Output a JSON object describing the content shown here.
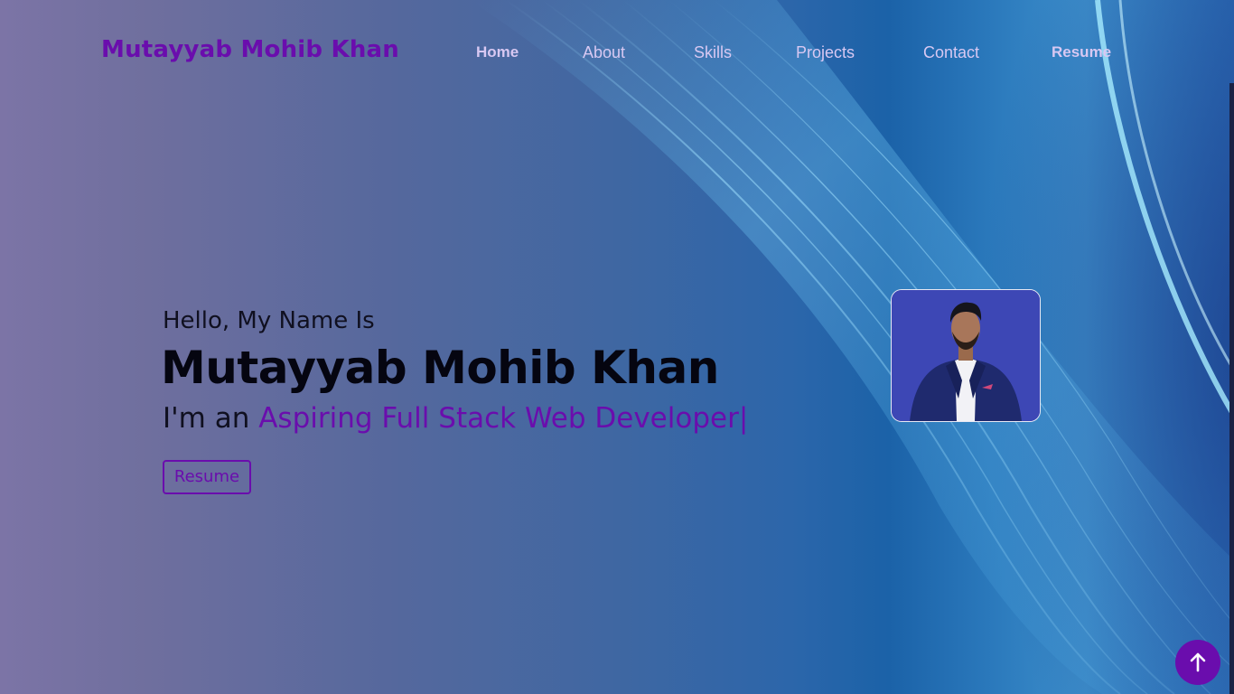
{
  "header": {
    "brand": "Mutayyab Mohib Khan"
  },
  "nav": {
    "items": [
      {
        "label": "Home"
      },
      {
        "label": "About"
      },
      {
        "label": "Skills"
      },
      {
        "label": "Projects"
      },
      {
        "label": "Contact"
      },
      {
        "label": "Resume"
      }
    ]
  },
  "hero": {
    "greeting": "Hello, My Name Is",
    "name": "Mutayyab Mohib Khan",
    "tagline_prefix": "I'm an ",
    "tagline_role": "Aspiring Full Stack Web Developer",
    "cursor": "|",
    "resume_button": "Resume"
  },
  "icons": {
    "back_to_top": "arrow-up-icon"
  },
  "colors": {
    "accent": "#6a0dad",
    "nav_text": "#d8c8f2",
    "photo_bg": "#3d47b5"
  }
}
